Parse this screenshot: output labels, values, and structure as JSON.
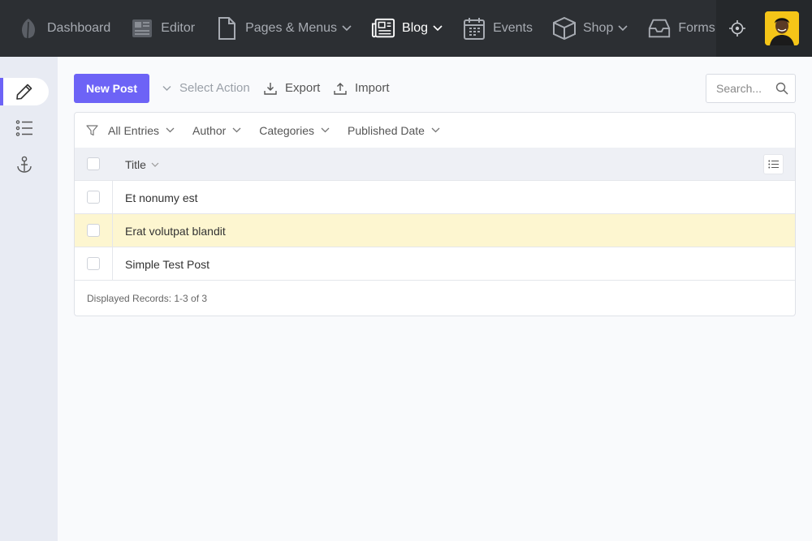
{
  "nav": {
    "items": [
      {
        "label": "Dashboard",
        "icon": "leaf-icon"
      },
      {
        "label": "Editor",
        "icon": "newspaper-icon"
      },
      {
        "label": "Pages & Menus",
        "icon": "file-icon"
      },
      {
        "label": "Blog",
        "icon": "news-icon"
      },
      {
        "label": "Events",
        "icon": "calendar-icon"
      },
      {
        "label": "Shop",
        "icon": "box-icon"
      },
      {
        "label": "Forms",
        "icon": "inbox-icon"
      }
    ],
    "active": "Blog",
    "right_icons": [
      "crosshair-icon",
      "avatar"
    ]
  },
  "sidebar": {
    "items": [
      {
        "icon": "pencil-icon",
        "active": true
      },
      {
        "icon": "list-icon",
        "active": false
      },
      {
        "icon": "anchor-icon",
        "active": false
      }
    ]
  },
  "toolbar": {
    "new_post": "New Post",
    "select_action": "Select Action",
    "export": "Export",
    "import": "Import",
    "search_placeholder": "Search..."
  },
  "filters": [
    "All Entries",
    "Author",
    "Categories",
    "Published Date"
  ],
  "table": {
    "column_title": "Title",
    "rows": [
      {
        "title": "Et nonumy est",
        "highlighted": false
      },
      {
        "title": "Erat volutpat blandit",
        "highlighted": true
      },
      {
        "title": "Simple Test Post",
        "highlighted": false
      }
    ]
  },
  "footer": {
    "records": "Displayed Records: 1-3 of 3"
  },
  "colors": {
    "accent": "#6d63f6",
    "topbar": "#2c2f33",
    "highlight_row": "#fdf6d0",
    "sidebar": "#e8ebf3"
  }
}
